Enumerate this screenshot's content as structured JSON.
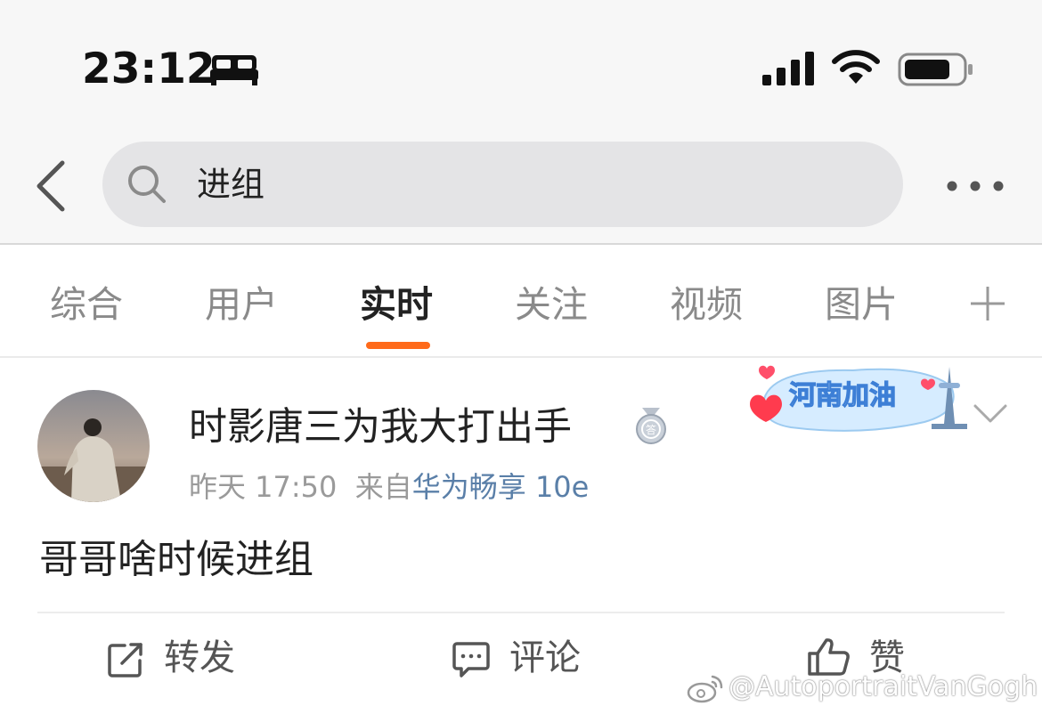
{
  "status_bar": {
    "time": "23:12",
    "icons": [
      "sleep-icon",
      "signal-icon",
      "wifi-icon",
      "battery-icon"
    ]
  },
  "search": {
    "value": "进组",
    "icons": [
      "back-icon",
      "search-icon",
      "more-icon"
    ]
  },
  "tabs": [
    {
      "label": "综合",
      "active": false
    },
    {
      "label": "用户",
      "active": false
    },
    {
      "label": "实时",
      "active": true
    },
    {
      "label": "关注",
      "active": false
    },
    {
      "label": "视频",
      "active": false
    },
    {
      "label": "图片",
      "active": false
    }
  ],
  "post": {
    "username": "时影唐三为我大打出手",
    "badge_text": "河南加油",
    "time": "昨天 17:50",
    "from_label": "来自",
    "source": "华为畅享 10e",
    "text": "哥哥啥时候进组"
  },
  "actions": {
    "repost": "转发",
    "comment": "评论",
    "like": "赞"
  },
  "watermark": "@AutoportraitVanGogh",
  "colors": {
    "accent": "#ff6a1a",
    "link": "#5a7fa8",
    "muted": "#9a9a9a"
  }
}
